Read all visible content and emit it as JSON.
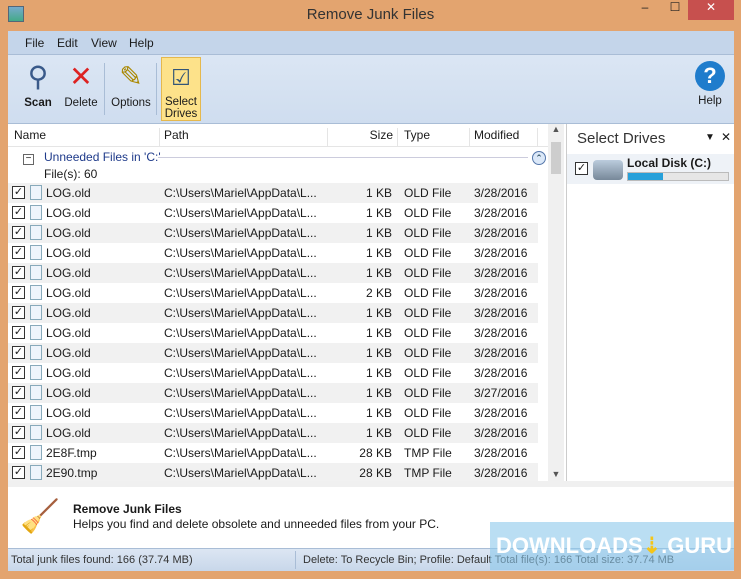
{
  "window": {
    "title": "Remove Junk Files",
    "minimize": "–",
    "maximize": "☐",
    "close": "✕"
  },
  "menu": [
    "File",
    "Edit",
    "View",
    "Help"
  ],
  "toolbar": {
    "scan": "Scan",
    "delete": "Delete",
    "options": "Options",
    "select_drives_1": "Select",
    "select_drives_2": "Drives",
    "help": "Help"
  },
  "columns": [
    "Name",
    "Path",
    "Size",
    "Type",
    "Modified"
  ],
  "group": {
    "title": "Unneeded Files in 'C:'",
    "count": "File(s): 60"
  },
  "rows": [
    {
      "name": "LOG.old",
      "path": "C:\\Users\\Mariel\\AppData\\L...",
      "size": "1 KB",
      "type": "OLD File",
      "modified": "3/28/2016"
    },
    {
      "name": "LOG.old",
      "path": "C:\\Users\\Mariel\\AppData\\L...",
      "size": "1 KB",
      "type": "OLD File",
      "modified": "3/28/2016"
    },
    {
      "name": "LOG.old",
      "path": "C:\\Users\\Mariel\\AppData\\L...",
      "size": "1 KB",
      "type": "OLD File",
      "modified": "3/28/2016"
    },
    {
      "name": "LOG.old",
      "path": "C:\\Users\\Mariel\\AppData\\L...",
      "size": "1 KB",
      "type": "OLD File",
      "modified": "3/28/2016"
    },
    {
      "name": "LOG.old",
      "path": "C:\\Users\\Mariel\\AppData\\L...",
      "size": "1 KB",
      "type": "OLD File",
      "modified": "3/28/2016"
    },
    {
      "name": "LOG.old",
      "path": "C:\\Users\\Mariel\\AppData\\L...",
      "size": "2 KB",
      "type": "OLD File",
      "modified": "3/28/2016"
    },
    {
      "name": "LOG.old",
      "path": "C:\\Users\\Mariel\\AppData\\L...",
      "size": "1 KB",
      "type": "OLD File",
      "modified": "3/28/2016"
    },
    {
      "name": "LOG.old",
      "path": "C:\\Users\\Mariel\\AppData\\L...",
      "size": "1 KB",
      "type": "OLD File",
      "modified": "3/28/2016"
    },
    {
      "name": "LOG.old",
      "path": "C:\\Users\\Mariel\\AppData\\L...",
      "size": "1 KB",
      "type": "OLD File",
      "modified": "3/28/2016"
    },
    {
      "name": "LOG.old",
      "path": "C:\\Users\\Mariel\\AppData\\L...",
      "size": "1 KB",
      "type": "OLD File",
      "modified": "3/28/2016"
    },
    {
      "name": "LOG.old",
      "path": "C:\\Users\\Mariel\\AppData\\L...",
      "size": "1 KB",
      "type": "OLD File",
      "modified": "3/27/2016"
    },
    {
      "name": "LOG.old",
      "path": "C:\\Users\\Mariel\\AppData\\L...",
      "size": "1 KB",
      "type": "OLD File",
      "modified": "3/28/2016"
    },
    {
      "name": "LOG.old",
      "path": "C:\\Users\\Mariel\\AppData\\L...",
      "size": "1 KB",
      "type": "OLD File",
      "modified": "3/28/2016"
    },
    {
      "name": "2E8F.tmp",
      "path": "C:\\Users\\Mariel\\AppData\\L...",
      "size": "28 KB",
      "type": "TMP File",
      "modified": "3/28/2016"
    },
    {
      "name": "2E90.tmp",
      "path": "C:\\Users\\Mariel\\AppData\\L...",
      "size": "28 KB",
      "type": "TMP File",
      "modified": "3/28/2016"
    }
  ],
  "drives_panel": {
    "title": "Select Drives",
    "drive": "Local Disk (C:)",
    "used_fraction": 0.35
  },
  "info": {
    "title": "Remove Junk Files",
    "desc": "Helps you find and delete obsolete and unneeded files from your PC."
  },
  "status": {
    "left": "Total junk files found: 166 (37.74 MB)",
    "right": "Delete: To Recycle Bin; Profile: Default   Total file(s): 166   Total size: 37.74 MB"
  },
  "watermark": "DOWNLOADS.GURU"
}
